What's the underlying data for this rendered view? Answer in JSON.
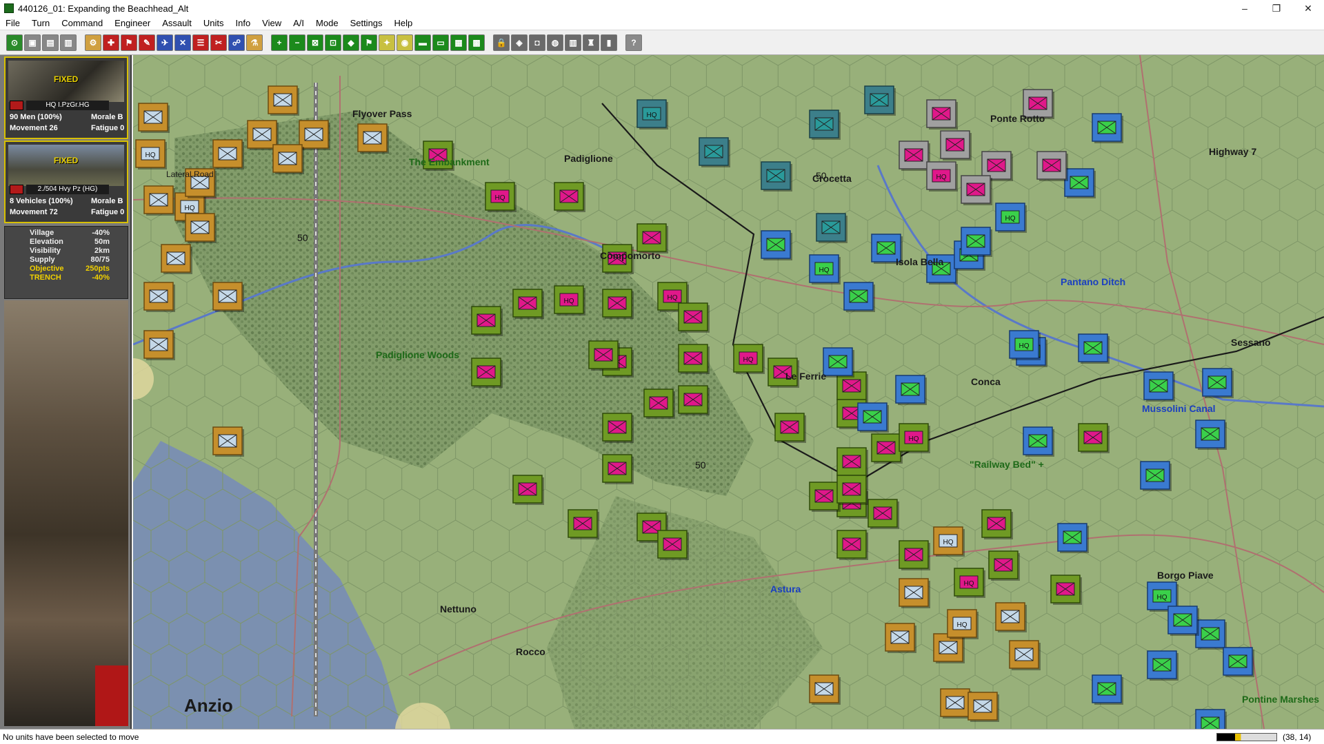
{
  "window": {
    "title": "440126_01: Expanding the Beachhead_Alt",
    "minimize": "–",
    "maximize": "❐",
    "close": "✕"
  },
  "menu": [
    "File",
    "Turn",
    "Command",
    "Engineer",
    "Assault",
    "Units",
    "Info",
    "View",
    "A/I",
    "Mode",
    "Settings",
    "Help"
  ],
  "toolbar": {
    "buttons": [
      {
        "name": "center-icon",
        "glyph": "⊙",
        "color": "#2a8a2a"
      },
      {
        "name": "tb-2-icon",
        "glyph": "▣",
        "color": "#888"
      },
      {
        "name": "tb-3-icon",
        "glyph": "▤",
        "color": "#888"
      },
      {
        "name": "tb-4-icon",
        "glyph": "▥",
        "color": "#888"
      },
      {
        "name": "tb-5-icon",
        "glyph": "⚙",
        "color": "#d0a040"
      },
      {
        "name": "tb-6-icon",
        "glyph": "✚",
        "color": "#c02020"
      },
      {
        "name": "tb-7-icon",
        "glyph": "⚑",
        "color": "#c02020"
      },
      {
        "name": "tb-8-icon",
        "glyph": "✎",
        "color": "#c02020"
      },
      {
        "name": "tb-9-icon",
        "glyph": "✈",
        "color": "#3050b0"
      },
      {
        "name": "tb-10-icon",
        "glyph": "✕",
        "color": "#3050b0"
      },
      {
        "name": "tb-11-icon",
        "glyph": "☰",
        "color": "#c02020"
      },
      {
        "name": "tb-12-icon",
        "glyph": "✂",
        "color": "#c02020"
      },
      {
        "name": "tb-13-icon",
        "glyph": "☍",
        "color": "#3050b0"
      },
      {
        "name": "tb-14-icon",
        "glyph": "⚗",
        "color": "#d0a040"
      },
      {
        "name": "zoom-in-icon",
        "glyph": "+",
        "color": "#1c8a1c"
      },
      {
        "name": "zoom-out-icon",
        "glyph": "−",
        "color": "#1c8a1c"
      },
      {
        "name": "tb-17-icon",
        "glyph": "⊠",
        "color": "#1c8a1c"
      },
      {
        "name": "tb-18-icon",
        "glyph": "⊡",
        "color": "#1c8a1c"
      },
      {
        "name": "tb-19-icon",
        "glyph": "◆",
        "color": "#1c8a1c"
      },
      {
        "name": "flag-icon",
        "glyph": "⚑",
        "color": "#1c8a1c"
      },
      {
        "name": "tb-21-icon",
        "glyph": "✦",
        "color": "#c8c040"
      },
      {
        "name": "tb-22-icon",
        "glyph": "◉",
        "color": "#c8c040"
      },
      {
        "name": "tb-23-icon",
        "glyph": "▬",
        "color": "#1c8a1c"
      },
      {
        "name": "tb-24-icon",
        "glyph": "▭",
        "color": "#1c8a1c"
      },
      {
        "name": "tb-25-icon",
        "glyph": "▦",
        "color": "#1c8a1c"
      },
      {
        "name": "tb-26-icon",
        "glyph": "▩",
        "color": "#1c8a1c"
      },
      {
        "name": "lock-icon",
        "glyph": "🔒",
        "color": "#6a6a6a"
      },
      {
        "name": "tb-28-icon",
        "glyph": "◈",
        "color": "#6a6a6a"
      },
      {
        "name": "tb-29-icon",
        "glyph": "◘",
        "color": "#6a6a6a"
      },
      {
        "name": "tb-30-icon",
        "glyph": "◍",
        "color": "#6a6a6a"
      },
      {
        "name": "tb-31-icon",
        "glyph": "▥",
        "color": "#6a6a6a"
      },
      {
        "name": "tb-32-icon",
        "glyph": "♜",
        "color": "#6a6a6a"
      },
      {
        "name": "tb-33-icon",
        "glyph": "▮",
        "color": "#6a6a6a"
      },
      {
        "name": "help-icon",
        "glyph": "?",
        "color": "#8a8a8a"
      }
    ]
  },
  "units_panel": {
    "unit1": {
      "status": "FIXED",
      "name": "HQ I.PzGr.HG",
      "men": "90 Men (100%)",
      "morale": "Morale B",
      "movement": "Movement 26",
      "fatigue": "Fatigue 0"
    },
    "unit2": {
      "status": "FIXED",
      "name": "2./504 Hvy Pz (HG)",
      "men": "8 Vehicles (100%)",
      "morale": "Morale B",
      "movement": "Movement 72",
      "fatigue": "Fatigue 0"
    }
  },
  "terrain": [
    {
      "label": "Village",
      "value": "-40%"
    },
    {
      "label": "Elevation",
      "value": "50m"
    },
    {
      "label": "Visibility",
      "value": "2km"
    },
    {
      "label": "Supply",
      "value": "80/75"
    },
    {
      "label": "Objective",
      "value": "250pts"
    },
    {
      "label": "TRENCH",
      "value": "-40%"
    }
  ],
  "map": {
    "labels": {
      "flyover_pass": "Flyover Pass",
      "lateral_road": "Lateral Road",
      "embankment": "The Embankment",
      "padiglione": "Padiglione",
      "crocetta": "Crocetta",
      "ponte_rotto": "Ponte Rotto",
      "highway7": "Highway 7",
      "compomorto": "Compomorto",
      "isola_bella": "Isola Bella",
      "pantano_ditch": "Pantano Ditch",
      "padiglione_woods": "Padiglione Woods",
      "sessano": "Sessano",
      "le_ferrie": "Le Ferrie",
      "conca": "Conca",
      "mussolini_canal": "Mussolini Canal",
      "railway_bed": "\"Railway Bed\" +",
      "astura": "Astura",
      "borgo_piave": "Borgo Piave",
      "nettuno": "Nettuno",
      "rocco": "Rocco",
      "anzio": "Anzio",
      "pontine_marshes": "Pontine Marshes"
    },
    "counter_hq": "HQ",
    "stack_value": "50"
  },
  "status": {
    "message": "No units have been selected to move",
    "coords": "(38, 14)"
  },
  "colors": {
    "german_infantry": "#c68f2c",
    "allied_us": "#6f9a24",
    "allied_blue": "#3a7ad0",
    "allied_teal": "#3c7f8a",
    "magenta": "#e0188a"
  }
}
